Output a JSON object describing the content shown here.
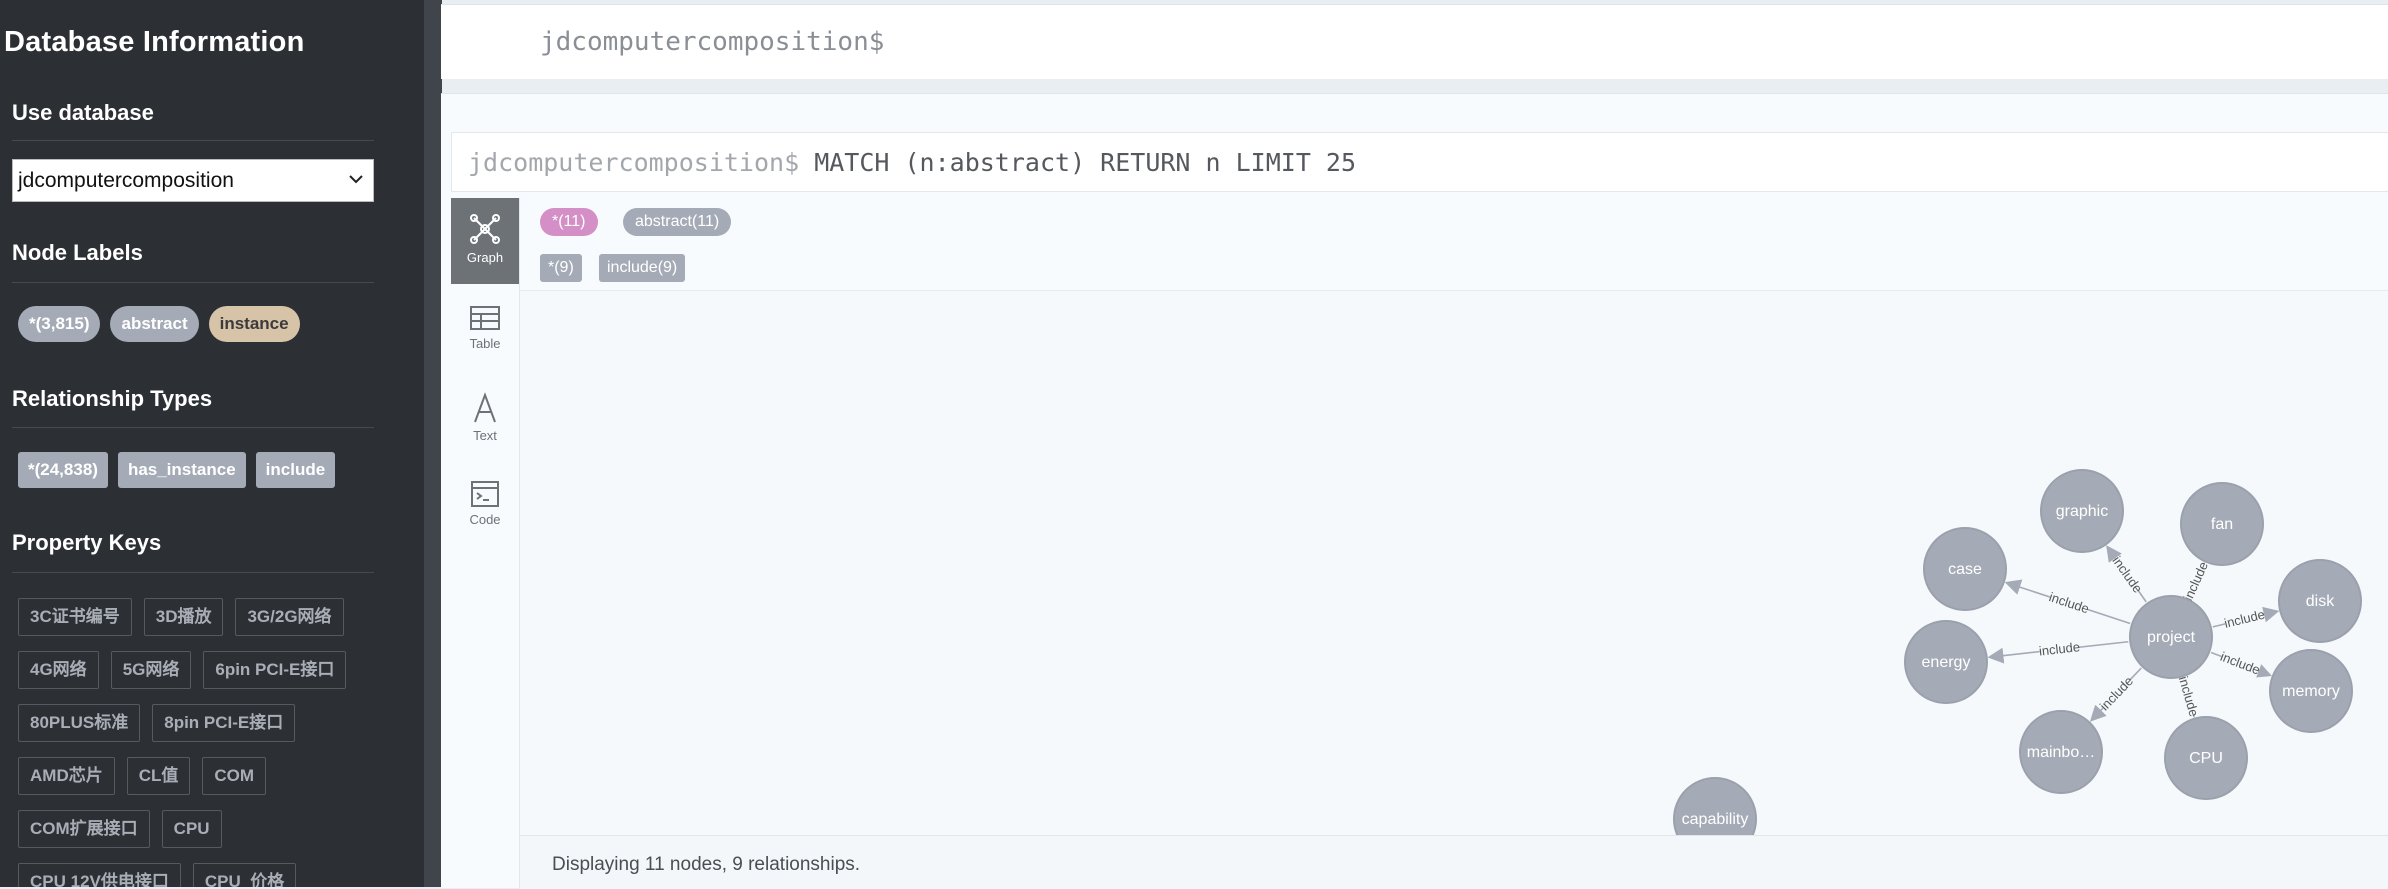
{
  "sidebar": {
    "title": "Database Information",
    "use_database": {
      "heading": "Use database",
      "selected": "jdcomputercomposition"
    },
    "node_labels": {
      "heading": "Node Labels",
      "items": [
        "*(3,815)",
        "abstract",
        "instance"
      ]
    },
    "relationship_types": {
      "heading": "Relationship Types",
      "items": [
        "*(24,838)",
        "has_instance",
        "include"
      ]
    },
    "property_keys": {
      "heading": "Property Keys",
      "rows": [
        [
          "3C证书编号",
          "3D播放",
          "3G/2G网络"
        ],
        [
          "4G网络",
          "5G网络",
          "6pin PCI-E接口"
        ],
        [
          "80PLUS标准",
          "8pin PCI-E接口"
        ],
        [
          "AMD芯片",
          "CL值",
          "COM"
        ],
        [
          "COM扩展接口",
          "CPU"
        ],
        [
          "CPU 12V供电接口",
          "CPU_价格"
        ]
      ]
    }
  },
  "top_frame": {
    "command": "jdcomputercomposition$"
  },
  "result_card": {
    "prompt": "jdcomputercomposition$",
    "query": " MATCH (n:abstract) RETURN n LIMIT 25",
    "views": [
      {
        "label": "Graph",
        "icon": "graph-icon"
      },
      {
        "label": "Table",
        "icon": "table-icon"
      },
      {
        "label": "Text",
        "icon": "text-icon"
      },
      {
        "label": "Code",
        "icon": "code-icon"
      }
    ],
    "legend_nodes": [
      {
        "label": "*(11)",
        "color": "#d38fc6"
      },
      {
        "label": "abstract(11)",
        "color": "#a5abb6"
      }
    ],
    "legend_rels": [
      "*(9)",
      "include(9)"
    ],
    "graph": {
      "center": "project",
      "nodes": [
        "graphic",
        "fan",
        "case",
        "disk",
        "energy",
        "memory",
        "mainbo…",
        "CPU",
        "capability"
      ],
      "edge_label": "include"
    },
    "status": "Displaying 11 nodes, 9 relationships."
  },
  "colors": {
    "sidebar_bg": "#2c3035",
    "node_fill": "#a5abb6",
    "node_stroke": "#9aa1ac",
    "pink": "#d38fc6",
    "tan": "#d7c3a8"
  }
}
